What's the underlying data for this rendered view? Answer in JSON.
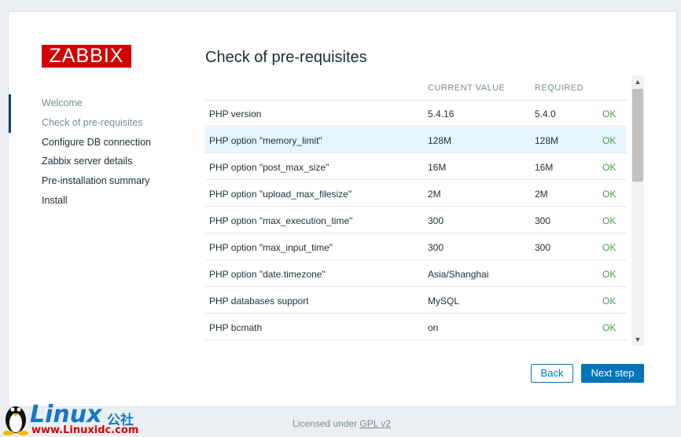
{
  "logo": {
    "text": "ZABBIX"
  },
  "sidebar": {
    "items": [
      {
        "label": "Welcome",
        "state": "done"
      },
      {
        "label": "Check of pre-requisites",
        "state": "done"
      },
      {
        "label": "Configure DB connection",
        "state": "pending"
      },
      {
        "label": "Zabbix server details",
        "state": "pending"
      },
      {
        "label": "Pre-installation summary",
        "state": "pending"
      },
      {
        "label": "Install",
        "state": "pending"
      }
    ]
  },
  "page_title": "Check of pre-requisites",
  "table": {
    "headers": {
      "current": "CURRENT VALUE",
      "required": "REQUIRED"
    },
    "rows": [
      {
        "name": "PHP version",
        "current": "5.4.16",
        "required": "5.4.0",
        "status": "OK"
      },
      {
        "name": "PHP option \"memory_limit\"",
        "current": "128M",
        "required": "128M",
        "status": "OK"
      },
      {
        "name": "PHP option \"post_max_size\"",
        "current": "16M",
        "required": "16M",
        "status": "OK"
      },
      {
        "name": "PHP option \"upload_max_filesize\"",
        "current": "2M",
        "required": "2M",
        "status": "OK"
      },
      {
        "name": "PHP option \"max_execution_time\"",
        "current": "300",
        "required": "300",
        "status": "OK"
      },
      {
        "name": "PHP option \"max_input_time\"",
        "current": "300",
        "required": "300",
        "status": "OK"
      },
      {
        "name": "PHP option \"date.timezone\"",
        "current": "Asia/Shanghai",
        "required": "",
        "status": "OK"
      },
      {
        "name": "PHP databases support",
        "current": "MySQL",
        "required": "",
        "status": "OK"
      },
      {
        "name": "PHP bcmath",
        "current": "on",
        "required": "",
        "status": "OK"
      }
    ]
  },
  "buttons": {
    "back": "Back",
    "next": "Next step"
  },
  "footer": {
    "license_prefix": "Licensed under",
    "license_link": "GPL v2"
  },
  "watermark": {
    "brand": "Linux",
    "brand_cn": "公社",
    "url": "www.Linuxidc.com"
  },
  "icons": {
    "scroll_up": "chevron-up-icon",
    "scroll_down": "chevron-down-icon",
    "tux": "tux-icon"
  },
  "colors": {
    "brand_red": "#d40000",
    "accent_blue": "#0275b8",
    "ok_green": "#429e47",
    "highlight_row": "#e8f5ff"
  }
}
